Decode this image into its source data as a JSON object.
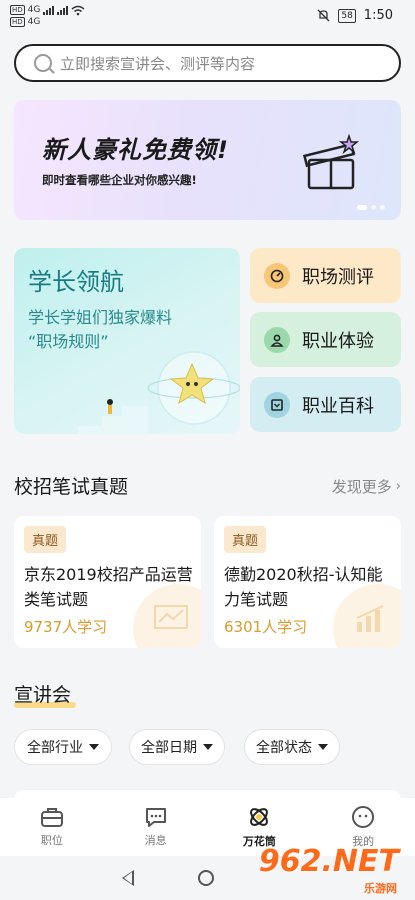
{
  "status_bar": {
    "hd_1": "HD",
    "hd_2": "HD",
    "net_1": "4G",
    "net_2": "4G",
    "battery": "58",
    "time": "1:50"
  },
  "search": {
    "placeholder": "立即搜索宣讲会、测评等内容"
  },
  "banner": {
    "title": "新人豪礼免费领!",
    "subtitle": "即时查看哪些企业对你感兴趣!"
  },
  "mentor_card": {
    "title": "学长领航",
    "line1": "学长学姐们独家爆料",
    "line2": "“职场规则”"
  },
  "quick_links": [
    {
      "label": "职场测评",
      "icon": "gauge-icon"
    },
    {
      "label": "职业体验",
      "icon": "person-icon"
    },
    {
      "label": "职业百科",
      "icon": "book-icon"
    }
  ],
  "exam_section": {
    "title": "校招笔试真题",
    "more": "发现更多",
    "items": [
      {
        "tag": "真题",
        "title": "京东2019校招产品运营类笔试题",
        "count": "9737人学习"
      },
      {
        "tag": "真题",
        "title": "德勤2020秋招-认知能力笔试题",
        "count": "6301人学习"
      }
    ]
  },
  "talk_section": {
    "title": "宣讲会",
    "filters": [
      "全部行业",
      "全部日期",
      "全部状态"
    ]
  },
  "tabs": [
    {
      "label": "职位",
      "icon": "briefcase-icon"
    },
    {
      "label": "消息",
      "icon": "message-icon"
    },
    {
      "label": "万花筒",
      "icon": "kaleidoscope-icon"
    },
    {
      "label": "我的",
      "icon": "profile-icon"
    }
  ],
  "watermark": {
    "number": "962.NET",
    "sub": "乐游网"
  },
  "colors": {
    "accent_orange": "#d99b2a",
    "mentor_teal": "#187b82"
  }
}
